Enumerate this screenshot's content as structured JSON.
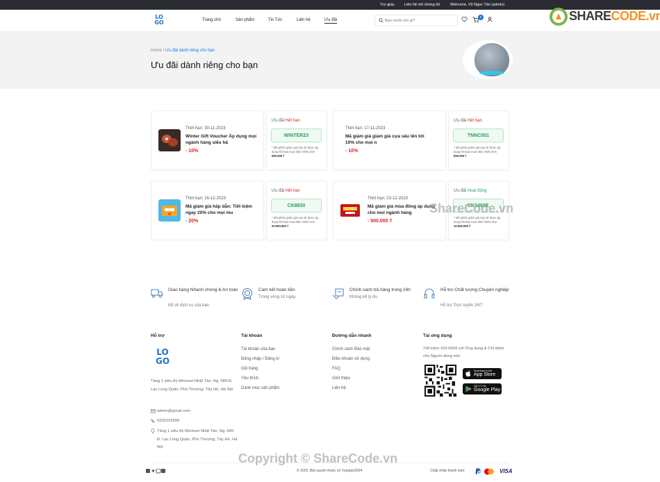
{
  "topbar": {
    "help": "Trợ giúp",
    "contact": "Liên hệ với chúng tôi",
    "welcome": "Welcome, Vũ Ngọc Tân (admin)"
  },
  "header": {
    "logo": "LOGO",
    "nav": [
      "Trang chủ",
      "Sản phẩm",
      "Tin Tức",
      "Liên hệ",
      "Ưu đãi"
    ],
    "search_placeholder": "Bạn muốn tìm gì?",
    "cart_count": "0",
    "icons": [
      "search-icon",
      "heart-icon",
      "cart-icon",
      "user-icon"
    ]
  },
  "banner": {
    "breadcrumb_home": "Home",
    "breadcrumb_sep": "/",
    "breadcrumb_current": "Ưu đãi dành riêng cho bạn",
    "title": "Ưu đãi dành riêng cho bạn"
  },
  "coupons": [
    {
      "date_label": "Thời hạn:",
      "date": "30-11-2023",
      "name": "Winter Gift Voucher Áp dụng mọi ngành hàng siêu hấ",
      "discount": "- 10%",
      "status_label": "Ưu đãi",
      "status": "Hết hạn",
      "code": "WINTER23",
      "note": "* Mã phiếu giảm giá này sẽ được áp dụng khi bạn mua sắm nhiều hơn",
      "min": "500.000 ₫"
    },
    {
      "date_label": "Thời hạn:",
      "date": "17-11-2023",
      "name": "Mã giảm giá giảm giá cựa sâu lên tới 10% cho mọi n",
      "discount": "- 10%",
      "status_label": "Ưu đãi",
      "status": "Hết hạn",
      "code": "TNNC001",
      "note": "* Mã phiếu giảm giá này sẽ được áp dụng khi bạn mua sắm nhiều hơn",
      "min": "500.000 ₫"
    },
    {
      "date_label": "Thời hạn:",
      "date": "16-12-2023",
      "name": "Mã giảm giá hấp dẫn: Tiết kiệm ngay 20% cho mọi mu",
      "discount": "- 20%",
      "status_label": "Ưu đãi",
      "status": "Hết hạn",
      "code": "CK8830",
      "note": "* Mã phiếu giảm giá này sẽ được áp dụng khi bạn mua sắm nhiều hơn",
      "min": "20.000.000 ₫"
    },
    {
      "date_label": "Thời hạn:",
      "date": "23-12-2023",
      "name": "Mã giảm giá mùa đông áp dụng cho mọi ngành hàng",
      "discount": "- 500.000 ₫",
      "status_label": "Ưu đãi",
      "status": "Hoạt động",
      "code": "CK0465K",
      "note": "* Mã phiếu giảm giá này sẽ được áp dụng khi bạn mua sắm nhiều hơn",
      "min": "10.000.000 ₫"
    }
  ],
  "features": [
    {
      "title": "Giao hàng Nhanh chóng & An toàn",
      "sub": "Kể về dịch vụ của bạn"
    },
    {
      "title": "Cam kết hoàn tiền",
      "sub": "Trong vòng 10 ngày."
    },
    {
      "title": "Chính sách trả hàng trong 24h",
      "sub": "Không kể lý do."
    },
    {
      "title": "Hỗ trợ Chất lượng Chuyên nghiệp",
      "sub": "Hỗ trợ Trực tuyến 24/7."
    }
  ],
  "footer": {
    "support_title": "Hỗ trợ",
    "address": "Tầng 1 siêu thị Winmart Nhật Tân, Ng. 689 Đ. Lạc Long Quân, Phú Thượng, Tây Hồ, Hà Nội",
    "email": "admin@gmail.com",
    "phone": "0332225690",
    "address2": "Tầng 1 siêu thị Winmart Nhật Tân, Ng. 689 Đ. Lạc Long Quân, Phú Thượng, Tây Hồ, Hà Nội",
    "account_title": "Tài khoản",
    "account_links": [
      "Tài khoản của bạn",
      "Đăng nhập / Đăng kí",
      "Giỏ hàng",
      "Yêu thích",
      "Danh mục sản phẩm"
    ],
    "quick_title": "Đường dẫn nhanh",
    "quick_links": [
      "Chính sách Bảo mật",
      "Điều khoản sử dụng",
      "FAQ",
      "Giới thiệu",
      "Liên hệ"
    ],
    "app_title": "Tải ứng dụng",
    "app_desc": "Tiết kiệm 100.000đ với Ứng dụng & Chỉ dành cho Người dùng mới",
    "appstore_small": "Download on the",
    "appstore_big": "App Store",
    "gplay_small": "GET IT ON",
    "gplay_big": "Google Play",
    "copyright": "© 2023. Bản quyền thuộc về Vungtan2004",
    "payment_label": "Chấp nhận thanh toán",
    "payment_visa": "VISA"
  },
  "watermarks": {
    "mid": "ShareCode.vn",
    "bottom": "Copyright © ShareCode.vn",
    "brand_a": "SHARE",
    "brand_b": "CODE.vn"
  },
  "colors": {
    "accent": "#1a73e8",
    "expired": "#d8232a",
    "active": "#2a9d5b",
    "topbar": "#2b2b33"
  }
}
